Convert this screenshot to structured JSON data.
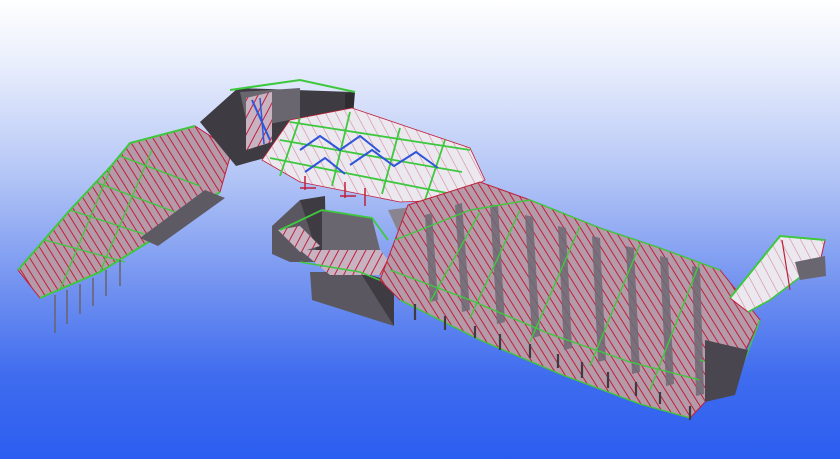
{
  "viewport": {
    "background_top": "#ffffff",
    "background_bottom": "#2b5df0"
  },
  "model": {
    "colors": {
      "steel_red": "#c0203a",
      "beam_green": "#3ec83e",
      "brace_blue": "#2f56d8",
      "slab_white": "#f1eef4",
      "concrete_gray": "#6a6670",
      "concrete_dark": "#3e3b42",
      "ramp_gray": "#8a8490"
    }
  }
}
